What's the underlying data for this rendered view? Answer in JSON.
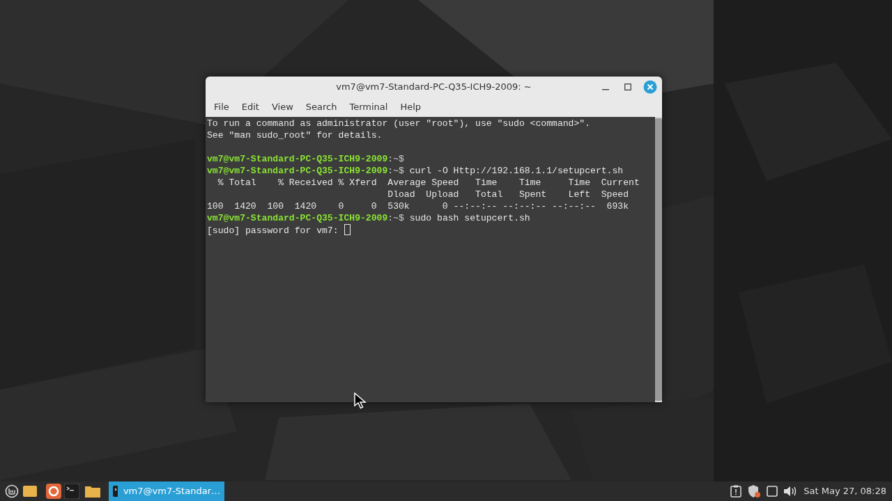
{
  "window": {
    "title": "vm7@vm7-Standard-PC-Q35-ICH9-2009: ~"
  },
  "menu": [
    "File",
    "Edit",
    "View",
    "Search",
    "Terminal",
    "Help"
  ],
  "terminal": {
    "lines": [
      {
        "kind": "output",
        "text": "To run a command as administrator (user \"root\"), use \"sudo <command>\"."
      },
      {
        "kind": "output",
        "text": "See \"man sudo_root\" for details."
      },
      {
        "kind": "blank"
      },
      {
        "kind": "prompt",
        "user_host": "vm7@vm7-Standard-PC-Q35-ICH9-2009",
        "path": ":~$"
      },
      {
        "kind": "prompt",
        "user_host": "vm7@vm7-Standard-PC-Q35-ICH9-2009",
        "path": ":~$",
        "command": "curl -O Http://192.168.1.1/setupcert.sh"
      },
      {
        "kind": "output",
        "text": "  % Total    % Received % Xferd  Average Speed   Time    Time     Time  Current"
      },
      {
        "kind": "output",
        "text": "                                 Dload  Upload   Total   Spent    Left  Speed"
      },
      {
        "kind": "output",
        "text": "100  1420  100  1420    0     0  530k      0 --:--:-- --:--:-- --:--:--  693k"
      },
      {
        "kind": "prompt",
        "user_host": "vm7@vm7-Standard-PC-Q35-ICH9-2009",
        "path": ":~$",
        "command": "sudo bash setupcert.sh"
      },
      {
        "kind": "output",
        "text": "[sudo] password for vm7:",
        "cursor": true
      }
    ]
  },
  "taskbar": {
    "task_button": {
      "label": "vm7@vm7-Standar…",
      "selected": true
    },
    "clock": "Sat May 27, 08:28"
  }
}
